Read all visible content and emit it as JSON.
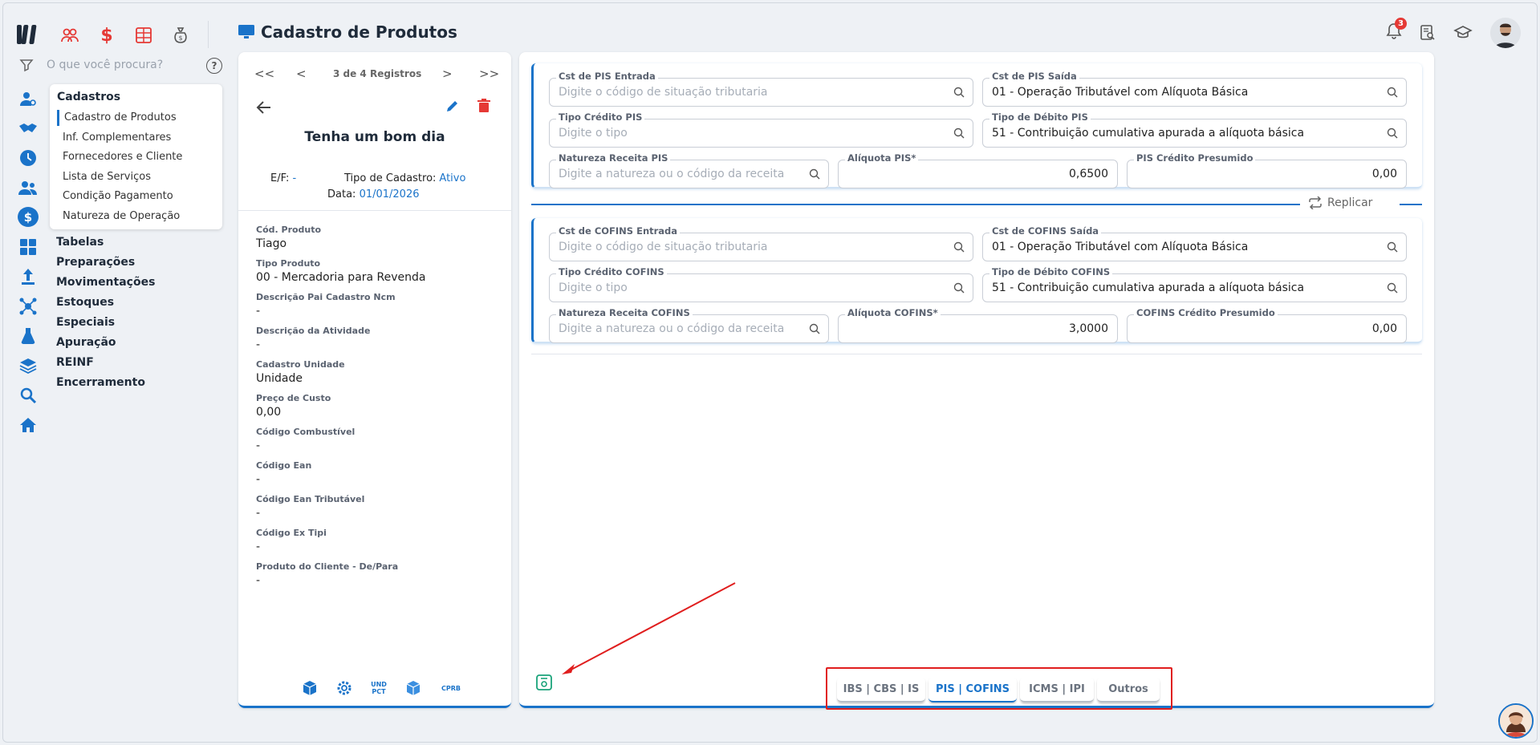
{
  "app": {
    "title": "Cadastro de Produtos"
  },
  "topbar": {
    "icons": [
      "users-icon",
      "dollar-icon",
      "calculator-icon",
      "money-bag-icon"
    ],
    "notification_count": "3",
    "right_icons": [
      "bell-icon",
      "document-search-icon",
      "graduation-cap-icon",
      "user-avatar"
    ]
  },
  "search": {
    "placeholder": "O que você procura?",
    "help": "?"
  },
  "sidebar": {
    "icons": [
      "user-settings-icon",
      "handshake-icon",
      "clock-icon",
      "people-icon",
      "dollar-circle-icon",
      "grid-icon",
      "upload-icon",
      "network-icon",
      "flask-icon",
      "layers-icon",
      "search-icon",
      "home-icon"
    ],
    "submenu": {
      "title": "Cadastros",
      "items": [
        "Cadastro de Produtos",
        "Inf. Complementares",
        "Fornecedores e Cliente",
        "Lista de Serviços",
        "Condição Pagamento",
        "Natureza de Operação"
      ]
    },
    "groups": [
      "Tabelas",
      "Preparações",
      "Movimentações",
      "Estoques",
      "Especiais",
      "Apuração",
      "REINF",
      "Encerramento"
    ]
  },
  "record": {
    "pager": {
      "first": "<<",
      "prev": "<",
      "count": "3 de 4 Registros",
      "next": ">",
      "last": ">>"
    },
    "greeting": "Tenha um bom dia",
    "ef_label": "E/F:",
    "ef_value": "-",
    "tipo_label": "Tipo de Cadastro:",
    "tipo_value": "Ativo",
    "data_label": "Data:",
    "data_value": "01/01/2026",
    "fields": [
      {
        "label": "Cód. Produto",
        "value": "Tiago"
      },
      {
        "label": "Tipo Produto",
        "value": "00 - Mercadoria para Revenda"
      },
      {
        "label": "Descrição Pai Cadastro Ncm",
        "value": "-"
      },
      {
        "label": "Descrição da Atividade",
        "value": "-"
      },
      {
        "label": "Cadastro Unidade",
        "value": "Unidade"
      },
      {
        "label": "Preço de Custo",
        "value": "0,00"
      },
      {
        "label": "Código Combustível",
        "value": "-"
      },
      {
        "label": "Código Ean",
        "value": "-"
      },
      {
        "label": "Código Ean Tributável",
        "value": "-"
      },
      {
        "label": "Código Ex Tipi",
        "value": "-"
      },
      {
        "label": "Produto do Cliente - De/Para",
        "value": "-"
      }
    ],
    "bottom_icons": {
      "und_pct_top": "UND",
      "und_pct_bottom": "PCT",
      "cprb": "CPRB"
    }
  },
  "pis": {
    "cst_entrada": {
      "label": "Cst de PIS Entrada",
      "placeholder": "Digite o código de situação tributaria"
    },
    "cst_saida": {
      "label": "Cst de PIS Saída",
      "value": "01 - Operação Tributável com Alíquota Básica"
    },
    "tipo_credito": {
      "label": "Tipo Crédito PIS",
      "placeholder": "Digite o tipo"
    },
    "tipo_debito": {
      "label": "Tipo de Débito PIS",
      "value": "51 - Contribuição cumulativa apurada a alíquota básica"
    },
    "natureza": {
      "label": "Natureza Receita PIS",
      "placeholder": "Digite a natureza ou o código da receita"
    },
    "aliquota": {
      "label": "Alíquota PIS*",
      "value": "0,6500"
    },
    "credito_presumido": {
      "label": "PIS Crédito Presumido",
      "value": "0,00"
    }
  },
  "replicar_label": "Replicar",
  "cofins": {
    "cst_entrada": {
      "label": "Cst de COFINS Entrada",
      "placeholder": "Digite o código de situação tributaria"
    },
    "cst_saida": {
      "label": "Cst de COFINS Saída",
      "value": "01 - Operação Tributável com Alíquota Básica"
    },
    "tipo_credito": {
      "label": "Tipo Crédito COFINS",
      "placeholder": "Digite o tipo"
    },
    "tipo_debito": {
      "label": "Tipo de Débito COFINS",
      "value": "51 - Contribuição cumulativa apurada a alíquota básica"
    },
    "natureza": {
      "label": "Natureza Receita COFINS",
      "placeholder": "Digite a natureza ou o código da receita"
    },
    "aliquota": {
      "label": "Alíquota COFINS*",
      "value": "3,0000"
    },
    "credito_presumido": {
      "label": "COFINS Crédito Presumido",
      "value": "0,00"
    }
  },
  "tabs": [
    {
      "label": "IBS | CBS | IS",
      "active": false
    },
    {
      "label": "PIS | COFINS",
      "active": true
    },
    {
      "label": "ICMS | IPI",
      "active": false
    },
    {
      "label": "Outros",
      "active": false
    }
  ],
  "colors": {
    "accent": "#1a73c9",
    "danger": "#e53935",
    "highlight": "#e01e1e",
    "save": "#1aa37a"
  }
}
